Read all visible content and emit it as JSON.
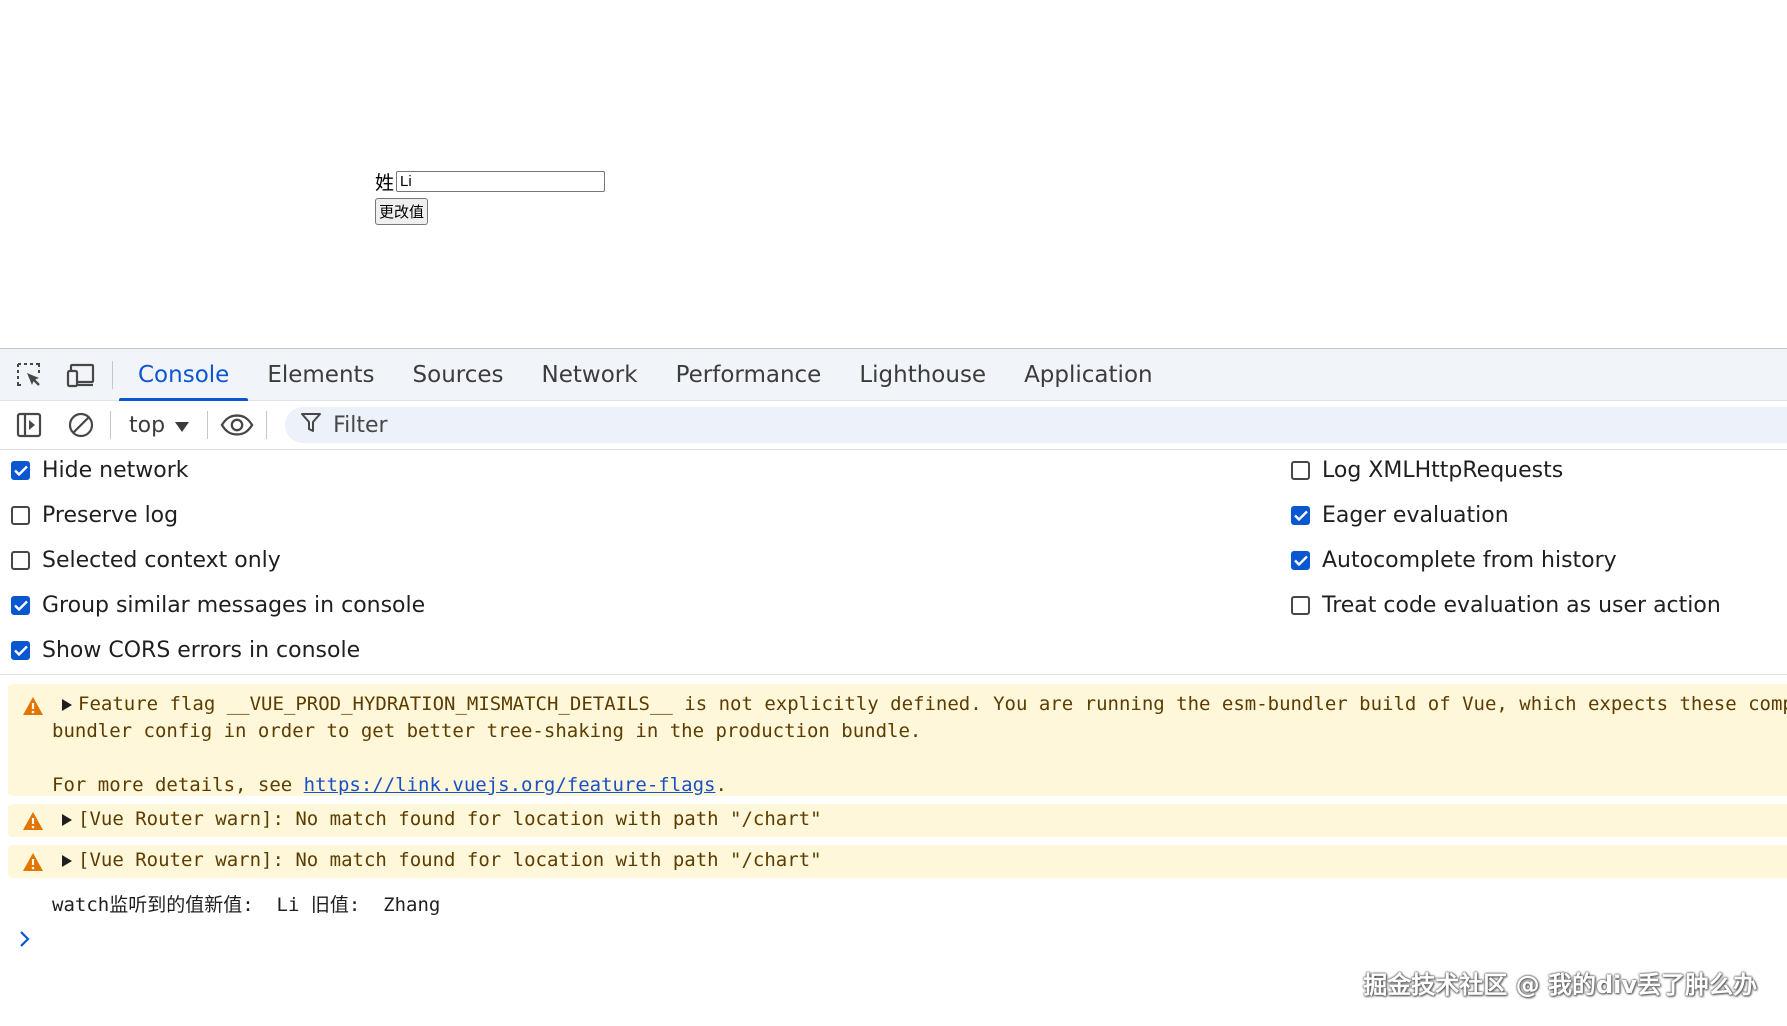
{
  "page": {
    "surname_label": "姓",
    "surname_value": "Li",
    "change_button": "更改值"
  },
  "devtools": {
    "tabs": [
      {
        "label": "Console",
        "active": true
      },
      {
        "label": "Elements"
      },
      {
        "label": "Sources"
      },
      {
        "label": "Network"
      },
      {
        "label": "Performance"
      },
      {
        "label": "Lighthouse"
      },
      {
        "label": "Application"
      }
    ],
    "toolbar": {
      "context": "top",
      "filter_placeholder": "Filter"
    },
    "settings": {
      "left": [
        {
          "label": "Hide network",
          "checked": true
        },
        {
          "label": "Preserve log",
          "checked": false
        },
        {
          "label": "Selected context only",
          "checked": false
        },
        {
          "label": "Group similar messages in console",
          "checked": true
        },
        {
          "label": "Show CORS errors in console",
          "checked": true
        }
      ],
      "right": [
        {
          "label": "Log XMLHttpRequests",
          "checked": false
        },
        {
          "label": "Eager evaluation",
          "checked": true
        },
        {
          "label": "Autocomplete from history",
          "checked": true
        },
        {
          "label": "Treat code evaluation as user action",
          "checked": false
        }
      ]
    },
    "console": {
      "warning1": {
        "line1": "Feature flag __VUE_PROD_HYDRATION_MISMATCH_DETAILS__ is not explicitly defined. You are running the esm-bundler build of Vue, which expects these compil",
        "line2": "bundler config in order to get better tree-shaking in the production bundle.",
        "line3_prefix": "For more details, see ",
        "link": "https://link.vuejs.org/feature-flags",
        "line3_suffix": "."
      },
      "warning2": "[Vue Router warn]: No match found for location with path \"/chart\"",
      "warning3": "[Vue Router warn]: No match found for location with path \"/chart\"",
      "log": "watch监听到的值新值:  Li 旧值:  Zhang"
    },
    "colors": {
      "accent": "#0b57d0",
      "warning_bg": "#fef7d9",
      "warning_icon": "#e37400"
    }
  },
  "watermark": "掘金技术社区 @ 我的div丢了肿么办"
}
